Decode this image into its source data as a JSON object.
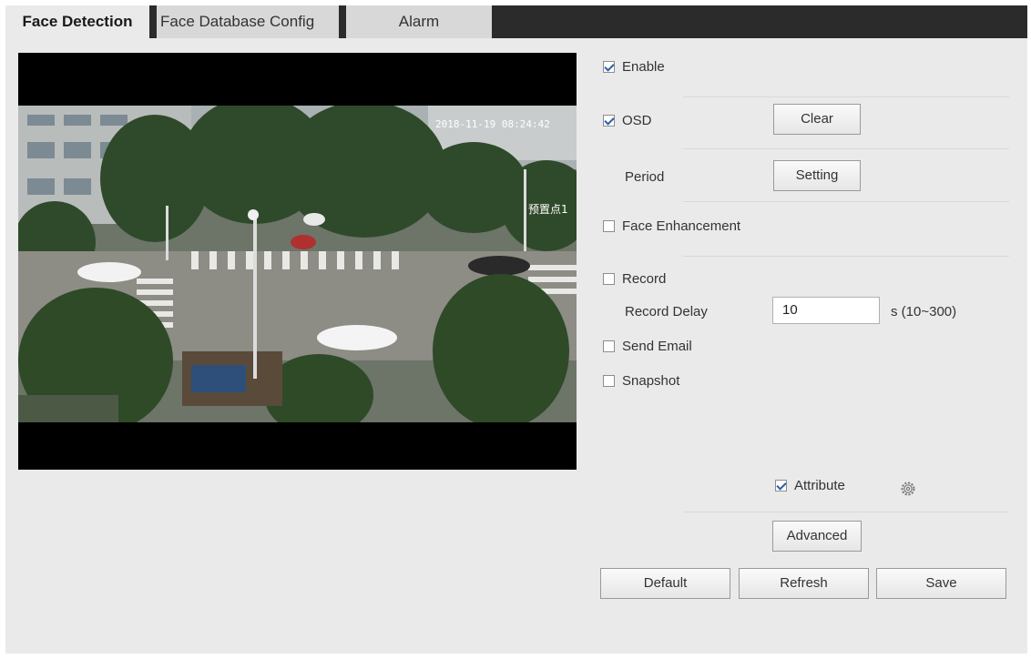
{
  "tabs": [
    {
      "label": "Face Detection",
      "active": true
    },
    {
      "label": "Face Database Config",
      "active": false
    },
    {
      "label": "Alarm",
      "active": false
    }
  ],
  "video": {
    "timestamp": "2018-11-19 08:24:42",
    "preset_label": "预置点1"
  },
  "options": {
    "enable": {
      "label": "Enable",
      "checked": true
    },
    "osd": {
      "label": "OSD",
      "checked": true,
      "button": "Clear"
    },
    "period": {
      "label": "Period",
      "button": "Setting"
    },
    "face_enhancement": {
      "label": "Face Enhancement",
      "checked": false
    },
    "record": {
      "label": "Record",
      "checked": false
    },
    "record_delay": {
      "label": "Record Delay",
      "value": "10",
      "range": "s (10~300)"
    },
    "send_email": {
      "label": "Send Email",
      "checked": false
    },
    "snapshot": {
      "label": "Snapshot",
      "checked": false
    },
    "attribute": {
      "label": "Attribute",
      "checked": true,
      "icon": "gear-icon"
    }
  },
  "buttons": {
    "advanced": "Advanced",
    "default": "Default",
    "refresh": "Refresh",
    "save": "Save"
  }
}
